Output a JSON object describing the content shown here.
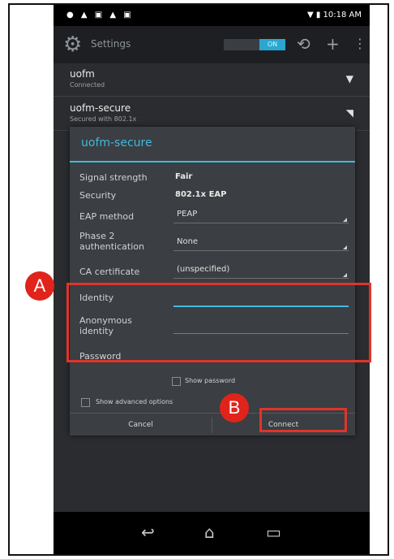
{
  "status_bar": {
    "left_icons": "● ▲ ▣ ▲ ▣",
    "right": "▼ ▮ 10:18 AM"
  },
  "action_bar": {
    "title": "Settings",
    "toggle_label": "ON",
    "icons": [
      "settings-gear-icon",
      "wps-icon",
      "add-icon",
      "overflow-menu-icon"
    ]
  },
  "networks": [
    {
      "name": "uofm",
      "status": "Connected"
    },
    {
      "name": "uofm-secure",
      "status": "Secured with 802.1x"
    }
  ],
  "dialog": {
    "title": "uofm-secure",
    "signal_strength_label": "Signal strength",
    "signal_strength_value": "Fair",
    "security_label": "Security",
    "security_value": "802.1x EAP",
    "eap_method_label": "EAP method",
    "eap_method_value": "PEAP",
    "phase2_label": "Phase 2 authentication",
    "phase2_value": "None",
    "ca_cert_label": "CA certificate",
    "ca_cert_value": "(unspecified)",
    "identity_label": "Identity",
    "anon_identity_label": "Anonymous identity",
    "password_label": "Password",
    "show_password_label": "Show password",
    "show_advanced_label": "Show advanced options",
    "cancel_label": "Cancel",
    "connect_label": "Connect"
  },
  "annotations": {
    "badge_a": "A",
    "badge_b": "B",
    "accent_color": "#e0241b"
  },
  "nav": {
    "icons": [
      "back-icon",
      "home-icon",
      "recent-apps-icon"
    ]
  }
}
